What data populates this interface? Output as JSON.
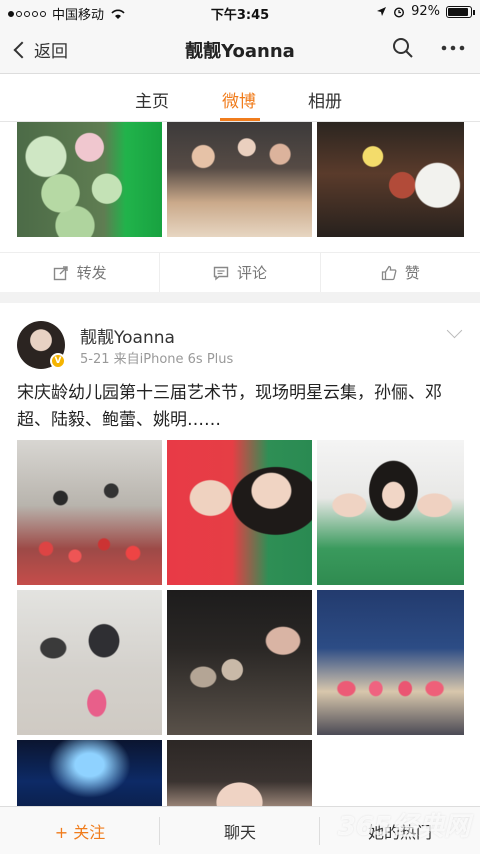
{
  "status": {
    "carrier": "中国移动",
    "time": "下午3:45",
    "battery": "92%"
  },
  "nav": {
    "back_label": "返回",
    "title": "靓靓Yoanna"
  },
  "tabs": [
    {
      "label": "主页"
    },
    {
      "label": "微博"
    },
    {
      "label": "相册"
    }
  ],
  "prev_post": {
    "actions": [
      {
        "label": "转发"
      },
      {
        "label": "评论"
      },
      {
        "label": "赞"
      }
    ]
  },
  "post": {
    "user_name": "靓靓Yoanna",
    "meta": "5-21  来自iPhone 6s Plus",
    "text": "宋庆龄幼儿园第十三届艺术节，现场明星云集，孙俪、邓超、陆毅、鲍蕾、姚明……"
  },
  "bottom_bar": {
    "follow_label": "+ 关注",
    "chat_label": "聊天",
    "hot_label": "她的热门"
  },
  "watermark": "365经典网",
  "colors": {
    "accent": "#f07c1c",
    "text": "#333333",
    "muted": "#999999"
  }
}
